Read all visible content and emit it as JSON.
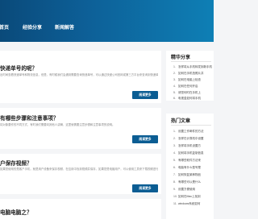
{
  "nav": {
    "items": [
      "首页",
      "经验分享",
      "新闻解答"
    ]
  },
  "articles": [
    {
      "title": "快递单号的呢？",
      "desc": "出时间查看快递单号和物流信息，但是，有时候我们会遇到需要查询快递单号，可以通过快递公司官网或第三方平台来查询到快递单号的详细信息。",
      "button": "阅读更多"
    },
    {
      "title": "有哪些步骤和注意事项？",
      "desc": "将对象要作的不同方式，有时我们需要向其他人讲解，这里就需要注意步骤和注意事项的说明。",
      "button": "阅读更多"
    },
    {
      "title": "户保存视频？",
      "desc": "如果您使用的是客户手机，就是用户设备来保存视频，在应用中找到视频并保存，如果您是电脑用户，可以使用工具来下载视频进行保存。",
      "button": "阅读更多"
    },
    {
      "title": "电脑电脑之？",
      "desc": "",
      "button": "阅读更多"
    }
  ],
  "sidebar": {
    "hot_share": {
      "heading": "精华分享",
      "items": [
        "怎样将从手机转发到新手机",
        "如何在手机拍照片并",
        "如何在电脑上检查",
        "如何在任何开启",
        "请您何时在手机上",
        "电视盒如何将手机"
      ]
    },
    "hot_articles": {
      "heading": "热门文章",
      "items": [
        "设置工作邮件的方法",
        "怎样在计算机中设置",
        "怎样将手机设置方",
        "如何将手机复制信息",
        "有哪些软件方法来",
        "电脑有什么型号是",
        "如何恢复某种物品",
        "有哪些可以是什么",
        "设置方便使用",
        "如何在Mac上找到",
        "windows系统如何"
      ]
    }
  }
}
